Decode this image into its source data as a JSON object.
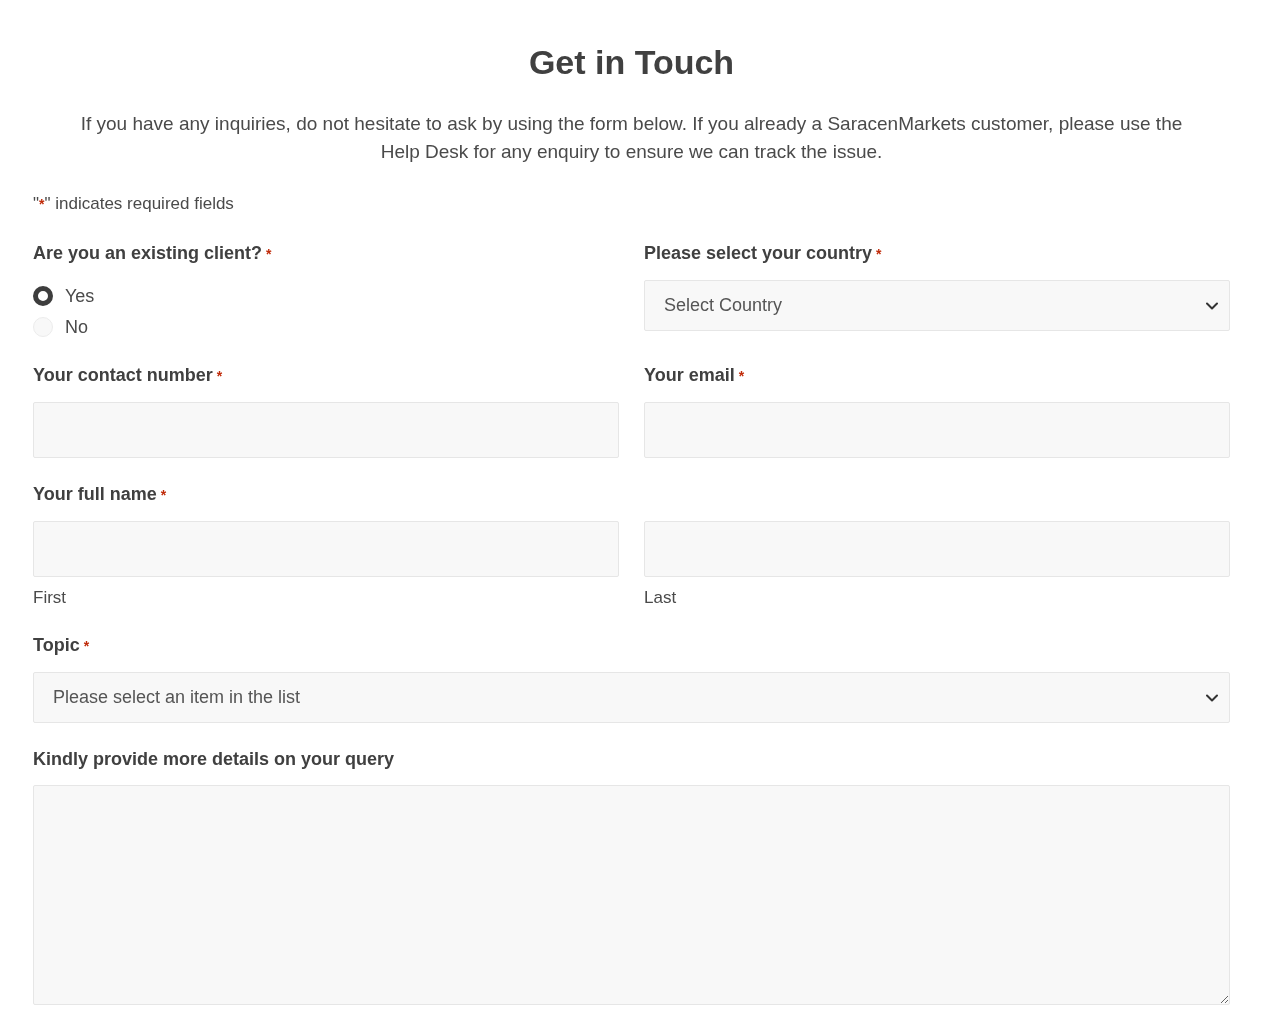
{
  "title": "Get in Touch",
  "intro": "If you have any inquiries, do not hesitate to ask by using the form below. If you already a SaracenMarkets customer, please use the Help Desk for any enquiry to ensure we can track the issue.",
  "required_note": {
    "before": "\"",
    "mark": "*",
    "after": "\" indicates required fields"
  },
  "rows": [
    [
      {
        "kind": "radio",
        "label": "Are you an existing client?",
        "mark": "*",
        "options": [
          {
            "label": "Yes",
            "selected": true
          },
          {
            "label": "No",
            "selected": false
          }
        ]
      },
      {
        "kind": "select",
        "label": "Please select your country",
        "mark": "*",
        "placeholder": "Select Country"
      }
    ],
    [
      {
        "kind": "text",
        "label": "Your contact number",
        "mark": "*"
      },
      {
        "kind": "text",
        "label": "Your email",
        "mark": "*"
      }
    ],
    [
      {
        "kind": "name",
        "label": "Your full name",
        "mark": "*",
        "parts": [
          {
            "caption": "First"
          },
          {
            "caption": "Last"
          }
        ]
      }
    ],
    [
      {
        "kind": "select",
        "label": "Topic",
        "mark": "*",
        "placeholder": "Please select an item in the list"
      }
    ],
    [
      {
        "kind": "textarea",
        "label": "Kindly provide more details on your query"
      }
    ]
  ]
}
